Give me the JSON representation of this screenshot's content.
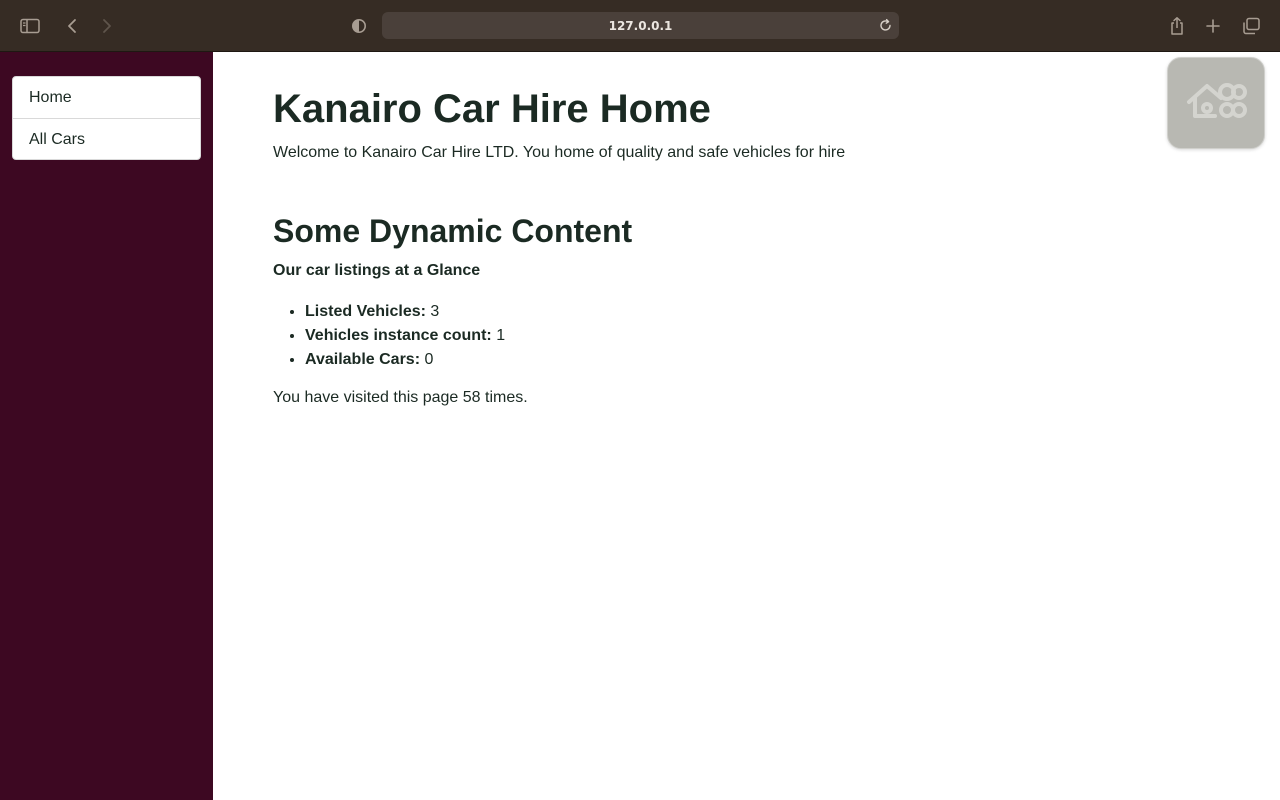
{
  "browser": {
    "url": "127.0.0.1",
    "icons": {
      "sidebar_toggle": "sidebar-icon",
      "back": "chevron-left-icon",
      "forward": "chevron-right-icon",
      "privacy": "shield-icon",
      "reload": "reload-icon",
      "share": "share-icon",
      "new_tab": "plus-icon",
      "tabs": "tabs-overview-icon"
    }
  },
  "sidebar": {
    "items": [
      {
        "label": "Home"
      },
      {
        "label": "All Cars"
      }
    ]
  },
  "main": {
    "title": "Kanairo Car Hire Home",
    "welcome": "Welcome to Kanairo Car Hire LTD. You home of quality and safe vehicles for hire",
    "section_title": "Some Dynamic Content",
    "glance_heading": "Our car listings at a Glance",
    "stats": [
      {
        "label": "Listed Vehicles:",
        "value": "3"
      },
      {
        "label": "Vehicles instance count:",
        "value": "1"
      },
      {
        "label": "Available Cars:",
        "value": "0"
      }
    ],
    "visits": "You have visited this page 58 times."
  },
  "colors": {
    "toolbar": "#362c24",
    "sidebar": "#3d0822",
    "text": "#1b2a23"
  }
}
